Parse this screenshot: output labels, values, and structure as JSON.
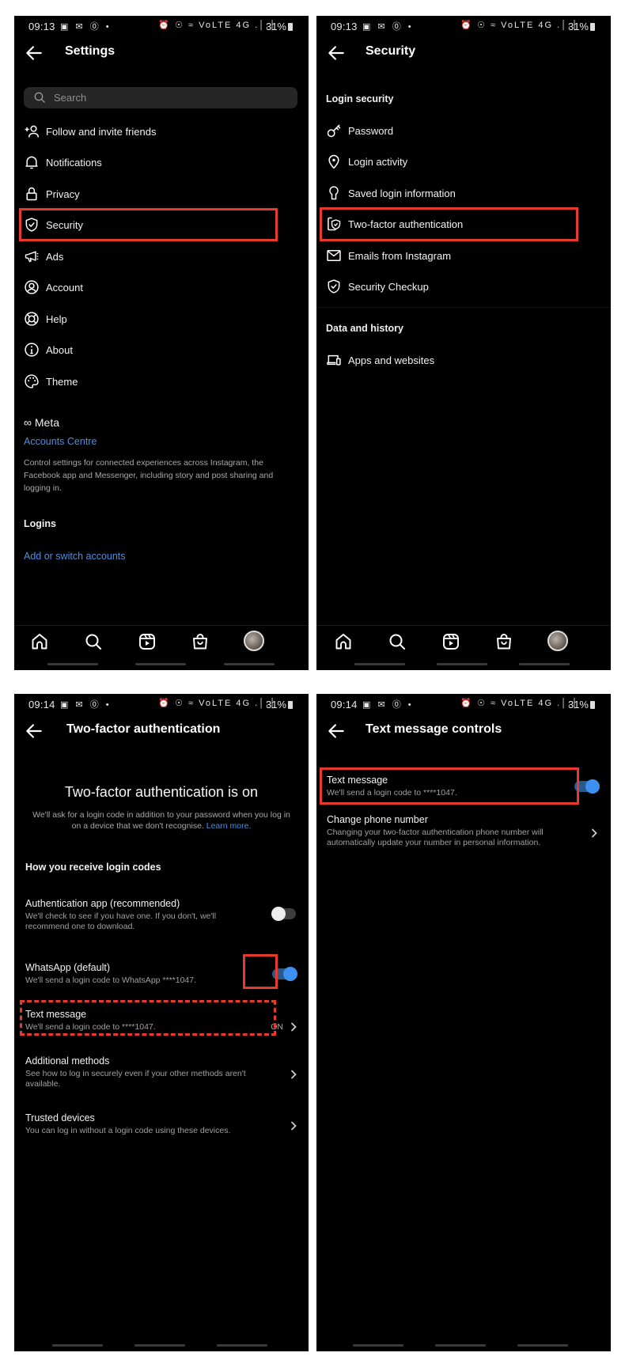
{
  "colors": {
    "accent": "#4d8fe0",
    "toggle_on": "#3d8ff0",
    "highlight": "#e53a2c",
    "background": "#000000"
  },
  "status_bar": {
    "screens_1_2_time": "09:13",
    "screens_3_4_time": "09:14",
    "left_icons": "▣ ✉ ⓪ •",
    "right_icons": "⏰ ☉ ≈ VoLTE 4G .│.│",
    "battery": "31%"
  },
  "settings": {
    "title": "Settings",
    "search_placeholder": "Search",
    "items": [
      {
        "label": "Follow and invite friends",
        "icon": "add-person-icon"
      },
      {
        "label": "Notifications",
        "icon": "bell-icon"
      },
      {
        "label": "Privacy",
        "icon": "lock-icon"
      },
      {
        "label": "Security",
        "icon": "shield-check-icon",
        "highlighted": true
      },
      {
        "label": "Ads",
        "icon": "megaphone-icon"
      },
      {
        "label": "Account",
        "icon": "account-circle-icon"
      },
      {
        "label": "Help",
        "icon": "lifebuoy-icon"
      },
      {
        "label": "About",
        "icon": "info-icon"
      },
      {
        "label": "Theme",
        "icon": "palette-icon"
      }
    ],
    "meta_brand": "∞ Meta",
    "accounts_centre": "Accounts Centre",
    "accounts_centre_desc": "Control settings for connected experiences across Instagram, the Facebook app and Messenger, including story and post sharing and logging in.",
    "logins_heading": "Logins",
    "add_switch_accounts": "Add or switch accounts"
  },
  "security": {
    "title": "Security",
    "login_security_heading": "Login security",
    "items": [
      {
        "label": "Password",
        "icon": "key-icon"
      },
      {
        "label": "Login activity",
        "icon": "location-pin-icon"
      },
      {
        "label": "Saved login information",
        "icon": "keyhole-icon"
      },
      {
        "label": "Two-factor authentication",
        "icon": "phone-shield-icon",
        "highlighted": true
      },
      {
        "label": "Emails from Instagram",
        "icon": "envelope-icon"
      },
      {
        "label": "Security Checkup",
        "icon": "shield-check-icon"
      }
    ],
    "data_history_heading": "Data and history",
    "apps_websites": "Apps and websites"
  },
  "bottom_nav": [
    "home-icon",
    "search-icon",
    "reels-icon",
    "shop-icon",
    "profile-avatar"
  ],
  "two_factor": {
    "title": "Two-factor authentication",
    "status_heading": "Two-factor authentication is on",
    "status_desc": "We'll ask for a login code in addition to your password when you log in on a device that we don't recognise.",
    "learn_more": "Learn more.",
    "receive_heading": "How you receive login codes",
    "auth_app_title": "Authentication app (recommended)",
    "auth_app_desc": "We'll check to see if you have one. If you don't, we'll recommend one to download.",
    "auth_app_enabled": false,
    "whatsapp_title": "WhatsApp (default)",
    "whatsapp_desc": "We'll send a login code to WhatsApp ****1047.",
    "whatsapp_enabled": true,
    "text_title": "Text message",
    "text_desc": "We'll send a login code to ****1047.",
    "text_status": "ON",
    "additional_title": "Additional methods",
    "additional_desc": "See how to log in securely even if your other methods aren't available.",
    "trusted_title": "Trusted devices",
    "trusted_desc": "You can log in without a login code using these devices."
  },
  "text_controls": {
    "title": "Text message controls",
    "text_title": "Text message",
    "text_desc": "We'll send a login code to ****1047.",
    "text_enabled": true,
    "change_title": "Change phone number",
    "change_desc": "Changing your two-factor authentication phone number will automatically update your number in personal information."
  }
}
